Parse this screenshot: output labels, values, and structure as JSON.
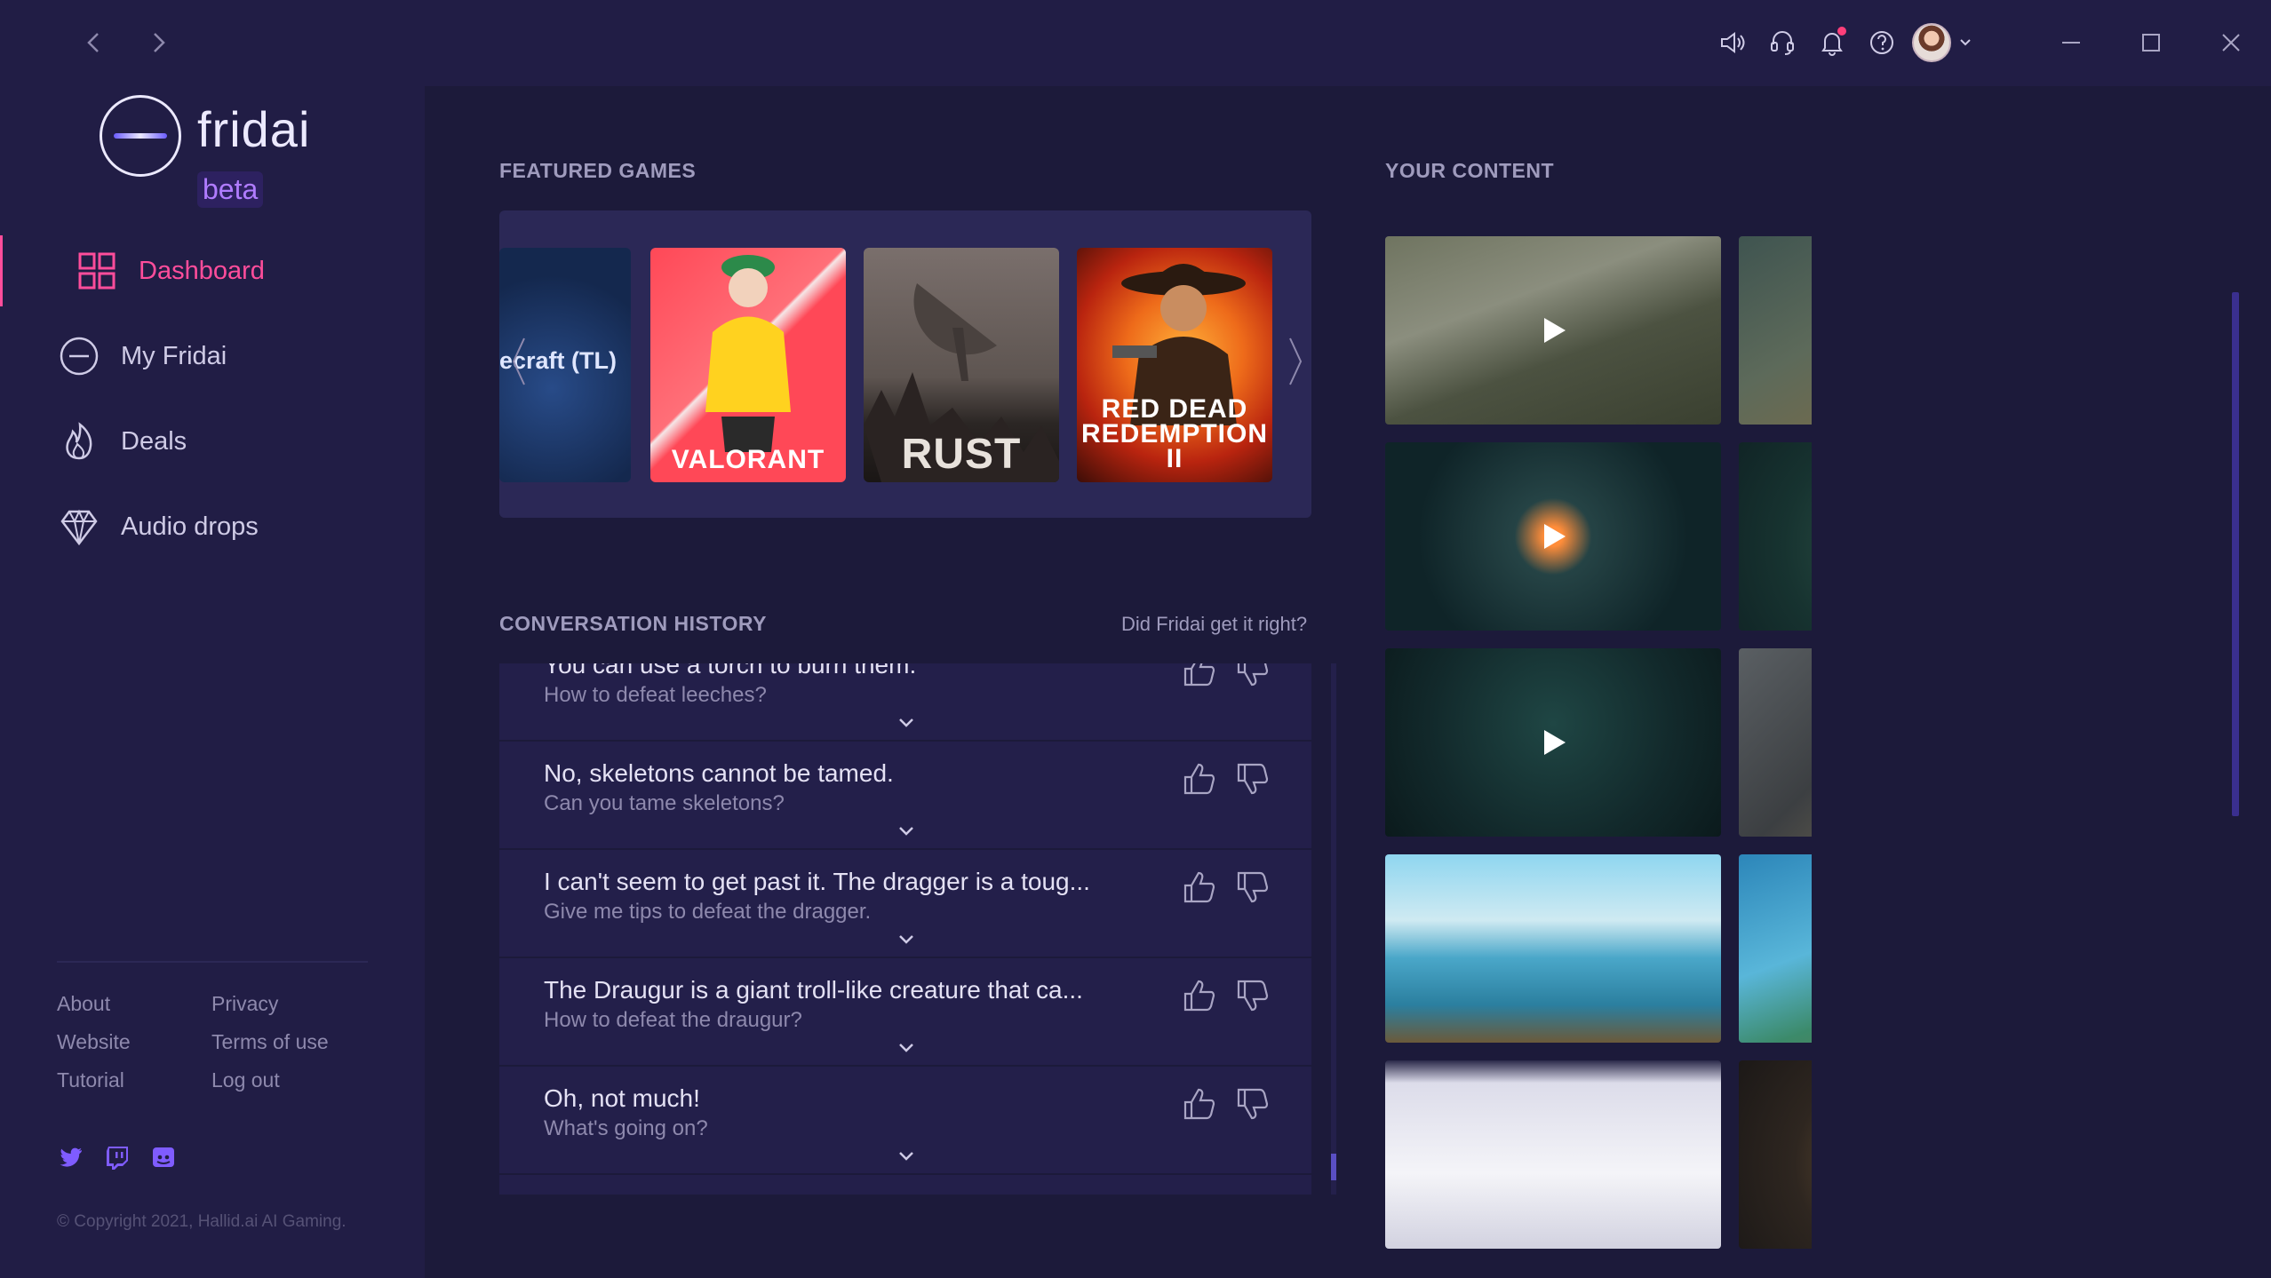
{
  "window": {
    "nav_back_icon": "chevron-left-icon",
    "nav_forward_icon": "chevron-right-icon",
    "top_icons": [
      "speaker-icon",
      "headset-icon",
      "bell-icon",
      "help-icon"
    ],
    "window_controls": [
      "minimize-icon",
      "maximize-icon",
      "close-icon"
    ]
  },
  "logo": {
    "name": "fridai",
    "badge": "beta"
  },
  "sidebar": {
    "items": [
      {
        "label": "Dashboard",
        "icon": "grid-icon",
        "active": true
      },
      {
        "label": "My Fridai",
        "icon": "fridai-logo-icon",
        "active": false
      },
      {
        "label": "Deals",
        "icon": "flame-icon",
        "active": false
      },
      {
        "label": "Audio drops",
        "icon": "diamond-icon",
        "active": false
      }
    ],
    "links": [
      "About",
      "Privacy",
      "Website",
      "Terms of use",
      "Tutorial",
      "Log out"
    ],
    "socials": [
      "twitter-icon",
      "twitch-icon",
      "discord-icon"
    ],
    "copyright": "© Copyright 2021, Hallid.ai AI Gaming."
  },
  "featured": {
    "title": "FEATURED GAMES",
    "partial_label": "ecraft (TL)",
    "games": [
      {
        "name": "VALORANT"
      },
      {
        "name": "RUST"
      },
      {
        "name": "RED DEAD REDEMPTION II"
      }
    ]
  },
  "conversation": {
    "title": "CONVERSATION HISTORY",
    "feedback_link": "Did Fridai get it right?",
    "items": [
      {
        "answer": "You can use a torch to burn them.",
        "question": "How to defeat leeches?"
      },
      {
        "answer": "No, skeletons cannot be tamed.",
        "question": "Can you tame skeletons?"
      },
      {
        "answer": "I can't seem to get past it. The dragger is a toug...",
        "question": "Give me tips to defeat the dragger."
      },
      {
        "answer": "The Draugur is a giant troll-like creature that ca...",
        "question": "How to defeat the draugur?"
      },
      {
        "answer": "Oh, not much!",
        "question": "What's going on?"
      }
    ]
  },
  "content": {
    "title": "YOUR CONTENT",
    "clips": [
      {
        "scene": "village-aerial",
        "has_play": true
      },
      {
        "scene": "forest-shore-soldier",
        "has_play": false
      },
      {
        "scene": "dark-forest-fire",
        "has_play": true
      },
      {
        "scene": "dark-forest-green",
        "has_play": true
      },
      {
        "scene": "dark-forest-night",
        "has_play": true
      },
      {
        "scene": "vehicle-road",
        "has_play": false
      },
      {
        "scene": "beach-dock-torches",
        "has_play": false
      },
      {
        "scene": "viking-boat-sea",
        "has_play": false
      },
      {
        "scene": "app-screenshot",
        "has_play": false
      },
      {
        "scene": "bestiary-screen",
        "has_play": false
      }
    ]
  },
  "colors": {
    "accent": "#ff4d9b",
    "background": "#1c1a3a",
    "sidebar": "#211d45",
    "panel": "#2b2856"
  }
}
